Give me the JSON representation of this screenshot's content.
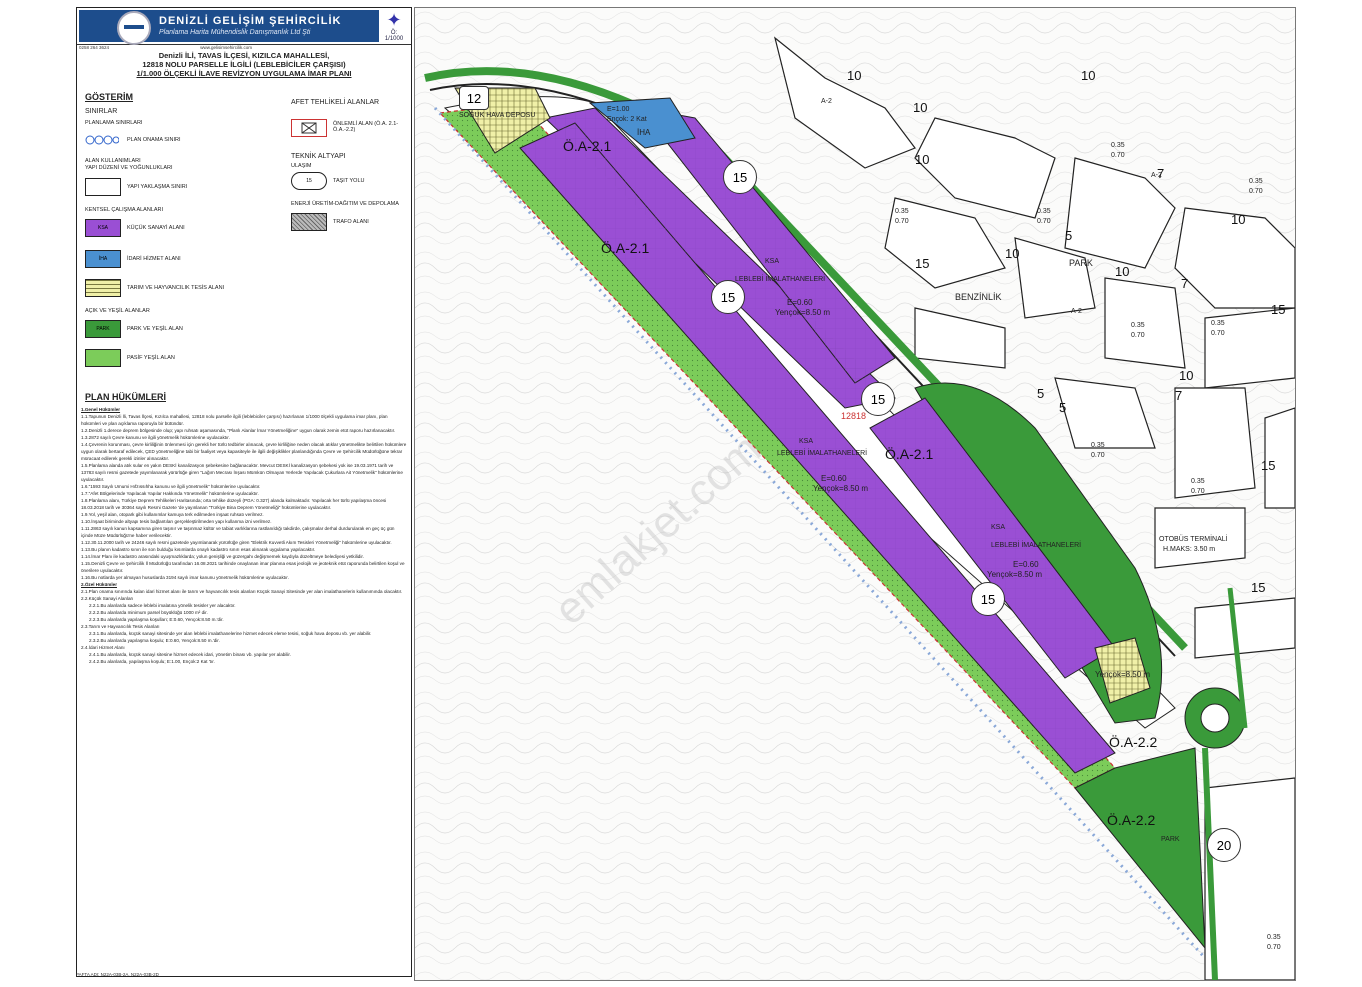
{
  "company": {
    "name": "DENİZLİ GELİŞİM ŞEHİRCİLİK",
    "subtitle": "Planlama Harita Mühendislik Danışmanlık Ltd Şti",
    "phone": "0258 264 3624",
    "web": "www.gelisimsehircilik.com"
  },
  "north_label": "Ö: 1/1000",
  "title": {
    "line1": "Denizli İLİ, TAVAS İLÇESİ, KIZILCA MAHALLESİ,",
    "line2": "12818 NOLU PARSELLE İLGİLİ (LEBLEBİCİLER ÇARŞISI)",
    "line3": "1/1.000 ÖLÇEKLİ İLAVE REVİZYON UYGULAMA İMAR PLANI"
  },
  "legend": {
    "heading": "GÖSTERİM",
    "sinirlar": "SINIRLAR",
    "planlama_sinirlari": "PLANLAMA SINIRLARI",
    "plan_onama_siniri": "PLAN ONAMA SINIRI",
    "alan_kullanimlari": "ALAN KULLANIMLARI",
    "yapi_duzeni": "YAPI DÜZENİ VE YOĞUNLUKLARI",
    "yapi_yaklasma": "YAPI YAKLAŞMA SINIRI",
    "kentsel": "KENTSEL ÇALIŞMA ALANLARI",
    "kucuk_sanayi": "KÜÇÜK SANAYİ ALANI",
    "ksa": "KSA",
    "idari": "İDARİ HİZMET ALANI",
    "iha": "İHA",
    "tarim": "TARIM VE HAYVANCILIK TESİS ALANI",
    "acik_yesil": "AÇIK VE YEŞİL ALANLAR",
    "park": "PARK VE YEŞİL ALAN",
    "park_sw": "PARK",
    "pasif": "PASİF YEŞİL ALAN",
    "afet": "AFET TEHLİKELİ ALANLAR",
    "onlemli": "ÖNLEMLİ ALAN (Ö.A. 2.1- Ö.A.-2.2)",
    "teknik": "TEKNİK ALTYAPI",
    "ulasim": "ULAŞIM",
    "tasit": "TAŞIT YOLU",
    "tasit_sw": "15",
    "enerji": "ENERJİ ÜRETİM-DAĞITIM VE DEPOLAMA",
    "trafo": "TRAFO ALANI"
  },
  "plan": {
    "heading": "PLAN HÜKÜMLERİ",
    "genel": "1.Genel Hükümler",
    "rules": [
      "1.1.Tapunun Denizli İli, Tavas İlçesi, Kızılca mahallesi, 12818 nolu parselle ilgili (leblebiciler çarşısı) hazırlanan 1/1000 ölçekli uygulama imar planı, plan hükümleri ve plan açıklama raporuyla bir bütündür.",
      "1.2.Denizli 1.derece deprem bölgesinde olup; yapı ruhsatı aşamasında, \"Planlı Alanlar İmar Yönetmeliğine\" uygun olarak zemin etüt raporu hazırlanacaktır.",
      "1.3.2872 sayılı Çevre kanunu ve ilgili yönetmelik hükümlerine uyulacaktır.",
      "1.4.Çevrenin korunması, çevre kirliliğinin önlenmesi için gerekli her türlü tedbirler alınacak, çevre kirliliğine neden olacak atıklar yönetmelikte belirtilen hükümlere uygun olarak bertaraf edilecek, ÇED yönetmeliğine tabi bir faaliyet veya kapasiteyle ile ilgili değişiklikler planlandığında Çevre ve Şehircilik Müdürlüğüne tekrar müracaat edilerek gerekli izinler alınacaktır.",
      "1.5.Planlama alanda atık sular en yakın DESKİ kanalizasyon şebekesine bağlanacaktır. Mevcut DESKİ kanalizasyon şebekesi yok ise 19.03.1971 tarih ve 13783 sayılı resmi gazetede yayımlanarak yürürlüğe giren \"Lağım Mecrası İnşası Mümkün Olmayan Yerlerde Yapılacak Çukurlara Ait Yönetmelik\" hükümlerine uyulacaktır.",
      "1.6.\"1593 Sayılı Umumi Hıfzıssıhha kanunu ve ilgili yönetmelik\" hükümlerine uyulacaktır.",
      "1.7.\"Afet Bölgelerinde Yapılacak Yapılar Hakkında Yönetmelik\" hükümlerine uyulacaktır.",
      "1.8.Planlama alanı, Türkiye Deprem Tehlikeleri Haritasında; orta tehlike düzeyli (PGA: 0.327) alanda kalmaktadır. Yapılacak her türlü yapılaşma öncesi 18.03.2018 tarih ve 30364 sayılı Resmi Gazete 'de yayınlanan \"Türkiye Bina Deprem Yönetmeliği\" hükümlerine uyulacaktır.",
      "1.9.Yol, yeşil alan, otopark gibi kullanımlar kamuya terk edilmeden inşaat ruhsatı verilmez.",
      "1.10.İnşaat biriminde altyapı tesis bağlantıları gerçekleştirilmeden yapı kullanma izni verilmez.",
      "1.11.2863 sayılı kanun kapsamına giren taşınır ve taşınmaz kültür ve tabiat varlıklarına rastlanıldığı takdirde, çalışmalar derhal durdurularak en geç üç gün içinde Müze Müdürlüğü'ne haber verilecektir.",
      "1.12.30.11.2000 tarih ve 24246 sayılı resmi gazetede yayımlanarak yürürlüğe giren \"Elektrik Kuvvetli Akım Tesisleri Yönetmeliği\" hükümlerine uyulacaktır.",
      "1.13.Bu planın kadastro sınırı ile son bulduğu kısımlarda onaylı kadastro sınırı esas alınarak uygulama yapılacaktır.",
      "1.14.İmar Planı ile kadastro arasındaki uyuşmazlıklarda; yolun genişliği ve güzergahı değişmemek kaydıyla düzeltmeye belediyesi yetkilidir.",
      "1.15.Denizli Çevre ve Şehircilik İl Müdürlüğü tarafından 16.08.2021 tarihinde onaylanan imar planına esas jeolojik ve jeoteknik etüt raporunda belirtilen koşul ve önerilere uyulacaktır.",
      "1.16.Bu notlarda yer almayan hususlarda 3194 sayılı imar kanunu yönetmelik hükümlerine uyulacaktır."
    ],
    "ozel": "2.Özel Hükümler",
    "ozel_rules": [
      "2.1.Plan onama sınırında kalan idari hizmet alanı ile tarım ve hayvancılık tesis alanları Küçük Sanayi Sitesinde yer alan imalathanelerin kullanımında olacaktır.",
      "2.2.Küçük Sanayi Alanları",
      "2.2.1.Bu alanlarda sadece leblebi imalatına yönelik tesisler yer alacaktır.",
      "2.2.2.Bu alanlarda minimum parsel büyüklüğü 1000 m² dir.",
      "2.2.3.Bu alanlarda yapılaşma koşulları; E:0.60, Yençok:8.50 m.'dir.",
      "2.3.Tarım ve Hayvancılık Tesis Alanları",
      "2.3.1.Bu alanlarda, küçük sanayi sitesinde yer alan leblebi imalathanelerine hizmet edecek eleme tesisi, soğuk hava deposu vb. yer alabilir.",
      "2.3.2.Bu alanlarda yapılaşma koşulu; E:0.60, Yençok:8.50 m.'dir.",
      "2.4.İdari Hizmet Alanı",
      "2.4.1.Bu alanlarda, küçük sanayi sitesine hizmet edecek idari, yönetim binası vb. yapılar yer alabilir.",
      "2.4.2.Bu alanlarda, yapılaşma koşulu; E:1.00, Ençok:2 Kat 'tır."
    ]
  },
  "footer": "PAFTA ADI: N22A-03B-2A, N22A-03B-2D",
  "map": {
    "zones": [
      "Ö.A-2.1",
      "Ö.A-2.1",
      "Ö.A-2.1",
      "Ö.A-2.2",
      "Ö.A-2.2"
    ],
    "road_widths": [
      "15",
      "15",
      "15",
      "15",
      "12",
      "20"
    ],
    "parcel": "12818",
    "ksa_label": "KSA",
    "iha_label": "İHA",
    "imalat": "LEBLEBİ İMALATHANELERİ",
    "density": "E=0.60",
    "height": "Yençok=8.50 m",
    "iha_cond": "E=1.00",
    "iha_cond2": "Ençok: 2 Kat",
    "tarim_cond": "Yençok=8.50 m",
    "tarim_label": "SOĞUK HAVA DEPOSU",
    "benzinlik": "BENZİNLİK",
    "park": "PARK",
    "park2": "PARK",
    "otogar": "OTOBÜS TERMİNALİ",
    "otogar2": "H.MAKS: 3.50 m",
    "right_numbers": [
      "10",
      "10",
      "10",
      "10",
      "7",
      "7",
      "10",
      "10",
      "10",
      "10",
      "15",
      "15",
      "15",
      "15",
      "5",
      "5",
      "5",
      "7",
      "20"
    ],
    "ratios": [
      "0.35",
      "0.70",
      "0.35",
      "0.70",
      "0.35",
      "0.70",
      "0.35",
      "0.70",
      "0.35",
      "0.70",
      "0.35",
      "0.70",
      "0.35",
      "0.70",
      "0.35",
      "0.70",
      "0.35",
      "0.70"
    ],
    "a2": "A-2",
    "a2_top": "5",
    "a2_bot": "3",
    "watermark": "emlakjet.com"
  },
  "colors": {
    "purple": "#9a4fd4",
    "green": "#3a9a3a",
    "light_green": "#7ccc5a",
    "blue": "#4a90d0",
    "yellow": "#f0f0a8"
  }
}
